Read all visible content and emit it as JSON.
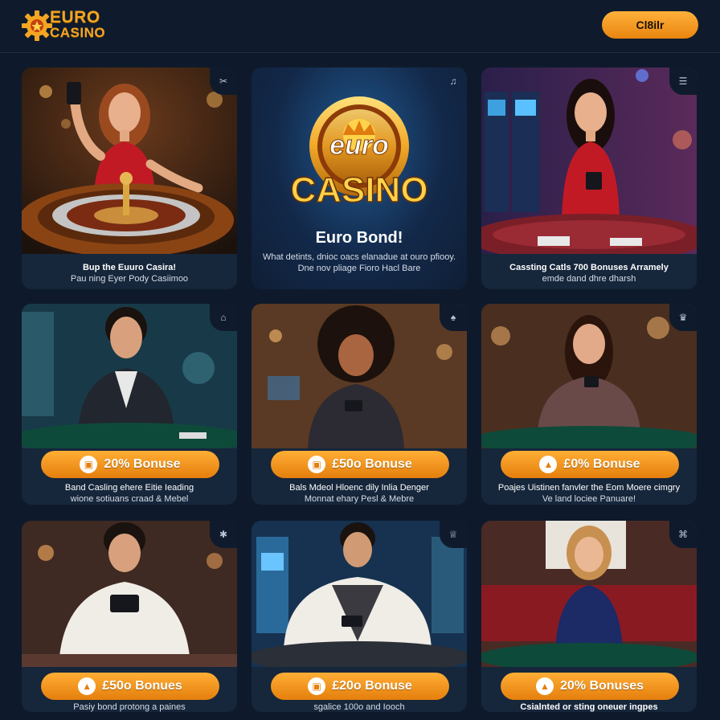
{
  "header": {
    "logo_line1": "EURO",
    "logo_line2": "CASINO",
    "cta_label": "Cl8ilr"
  },
  "colors": {
    "accent": "#f4a623",
    "background": "#0e1a2b",
    "card": "#16263b"
  },
  "cards": [
    {
      "icon": "ticket-icon",
      "caption_bold": "Bup the Euuro Casira!",
      "caption_normal": "Pau ning Eyer Pody Casiimoo"
    },
    {
      "icon": "music-icon",
      "logo_word1": "euro",
      "logo_word2": "CASINO",
      "headline": "Euro Bond!",
      "caption_line1": "What detints, dnioc oacs elanadue at ouro pfiooy.",
      "caption_line2": "Dne nov pliage Fioro Hacl Bare"
    },
    {
      "icon": "list-icon",
      "caption_bold": "Cassting Catls 700 Bonuses Arramely",
      "caption_normal": "emde dand dhre dharsh"
    },
    {
      "icon": "chair-icon",
      "bonus_label": "20% Bonuse",
      "caption_line1": "Band Casling ehere Eitie Ieading",
      "caption_line2": "wione sotiuans craad & Mebel"
    },
    {
      "icon": "cards-icon",
      "bonus_label": "£50o Bonuse",
      "caption_line1": "Bals Mdeol Hloenc dily Inlia Denger",
      "caption_line2": "Monnat ehary Pesl & Mebre"
    },
    {
      "icon": "trophy-icon",
      "bonus_label": "£0% Bonuse",
      "caption_line1": "Poajes Uistinen fanvler the Eom Moere cimgry",
      "caption_line2": "Ve land lociee Panuare!"
    },
    {
      "icon": "star-icon",
      "bonus_label": "£50o Bonues",
      "caption_line1": "Pasiy bond protong a paines"
    },
    {
      "icon": "crown-icon",
      "bonus_label": "£20o Bonuse",
      "caption_line1": "sgalice 100o and Iooch"
    },
    {
      "icon": "gift-icon",
      "bonus_label": "20% Bonuses",
      "caption_line1": "Csialnted or sting oneuer ingpes"
    }
  ]
}
